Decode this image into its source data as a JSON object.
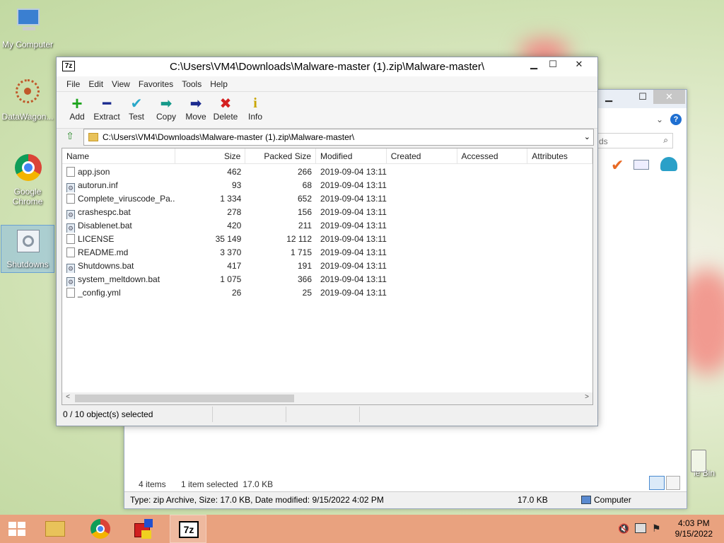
{
  "desktop": {
    "icons": [
      {
        "label": "My Computer"
      },
      {
        "label": "DataWagon..."
      },
      {
        "label": "Google Chrome"
      },
      {
        "label": "Shutdowns"
      },
      {
        "label": "le Bin"
      }
    ]
  },
  "explorer": {
    "search_placeholder": "ds",
    "items_count": "4 items",
    "selection": "1 item selected  17.0 KB",
    "details": "Type: zip Archive, Size: 17.0 KB, Date modified: 9/15/2022 4:02 PM",
    "size": "17.0 KB",
    "location": "Computer"
  },
  "zip": {
    "title": "C:\\Users\\VM4\\Downloads\\Malware-master (1).zip\\Malware-master\\",
    "app_icon_label": "7z",
    "menu": [
      "File",
      "Edit",
      "View",
      "Favorites",
      "Tools",
      "Help"
    ],
    "toolbar": [
      {
        "label": "Add",
        "icon": "+",
        "color": "#1fa51f"
      },
      {
        "label": "Extract",
        "icon": "━",
        "color": "#1b2b8f"
      },
      {
        "label": "Test",
        "icon": "✔",
        "color": "#2aa8c9"
      },
      {
        "label": "Copy",
        "icon": "➡",
        "color": "#159a8a"
      },
      {
        "label": "Move",
        "icon": "➡",
        "color": "#1b2b8f"
      },
      {
        "label": "Delete",
        "icon": "✖",
        "color": "#d42020"
      },
      {
        "label": "Info",
        "icon": "i",
        "color": "#c9a600"
      }
    ],
    "address": "C:\\Users\\VM4\\Downloads\\Malware-master (1).zip\\Malware-master\\",
    "columns": [
      "Name",
      "Size",
      "Packed Size",
      "Modified",
      "Created",
      "Accessed",
      "Attributes"
    ],
    "files": [
      {
        "name": "app.json",
        "size": "462",
        "packed": "266",
        "modified": "2019-09-04 13:11",
        "type": "file"
      },
      {
        "name": "autorun.inf",
        "size": "93",
        "packed": "68",
        "modified": "2019-09-04 13:11",
        "type": "gear"
      },
      {
        "name": "Complete_viruscode_Pa...",
        "size": "1 334",
        "packed": "652",
        "modified": "2019-09-04 13:11",
        "type": "file"
      },
      {
        "name": "crashespc.bat",
        "size": "278",
        "packed": "156",
        "modified": "2019-09-04 13:11",
        "type": "gear"
      },
      {
        "name": "Disablenet.bat",
        "size": "420",
        "packed": "211",
        "modified": "2019-09-04 13:11",
        "type": "gear"
      },
      {
        "name": "LICENSE",
        "size": "35 149",
        "packed": "12 112",
        "modified": "2019-09-04 13:11",
        "type": "file"
      },
      {
        "name": "README.md",
        "size": "3 370",
        "packed": "1 715",
        "modified": "2019-09-04 13:11",
        "type": "file"
      },
      {
        "name": "Shutdowns.bat",
        "size": "417",
        "packed": "191",
        "modified": "2019-09-04 13:11",
        "type": "gear"
      },
      {
        "name": "system_meltdown.bat",
        "size": "1 075",
        "packed": "366",
        "modified": "2019-09-04 13:11",
        "type": "gear"
      },
      {
        "name": "_config.yml",
        "size": "26",
        "packed": "25",
        "modified": "2019-09-04 13:11",
        "type": "file"
      }
    ],
    "status": "0 / 10 object(s) selected"
  },
  "taskbar": {
    "time": "4:03 PM",
    "date": "9/15/2022",
    "zip_label": "7z"
  }
}
